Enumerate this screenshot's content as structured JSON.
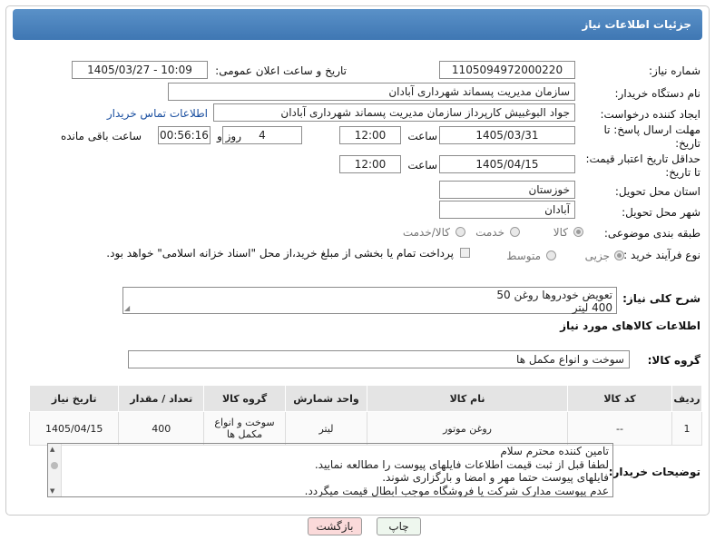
{
  "header": {
    "title": "جزئیات اطلاعات نیاز"
  },
  "form": {
    "need_number_label": "شماره نیاز:",
    "need_number": "1105094972000220",
    "announce_label": "تاریخ و ساعت اعلان عمومی:",
    "announce_value": "1405/03/27 - 10:09",
    "buyer_org_label": "نام دستگاه خریدار:",
    "buyer_org": "سازمان مدیریت پسماند شهرداری آبادان",
    "creator_label": "ایجاد کننده درخواست:",
    "creator": "جواد البوغبیش کارپرداز سازمان مدیریت پسماند شهرداری آبادان",
    "contact_link": "اطلاعات تماس خریدار",
    "reply_deadline_label_1": "مهلت ارسال پاسخ: تا",
    "reply_deadline_label_2": "تاریخ:",
    "reply_date": "1405/03/31",
    "time_label": "ساعت",
    "reply_time": "12:00",
    "days_value": "4",
    "days_label": "روز و",
    "remaining_time": "00:56:16",
    "remaining_label": "ساعت باقی مانده",
    "price_deadline_label_1": "حداقل تاریخ اعتبار قیمت:",
    "price_deadline_label_2": "تا تاریخ:",
    "price_date": "1405/04/15",
    "price_time": "12:00",
    "province_label": "استان محل تحویل:",
    "province": "خوزستان",
    "city_label": "شهر محل تحویل:",
    "city": "آبادان",
    "category_label": "طبقه بندی موضوعی:",
    "category_options": [
      "کالا",
      "خدمت",
      "کالا/خدمت"
    ],
    "process_label": "نوع فرآیند خرید :",
    "process_options": [
      "جزیی",
      "متوسط"
    ],
    "payment_note": "پرداخت تمام یا بخشی از مبلغ خرید،از محل \"اسناد خزانه اسلامی\" خواهد بود."
  },
  "description": {
    "label": "شرح کلی نیاز:",
    "line1": "تعویض خودروها روغن 50",
    "line2": "400 لیتر"
  },
  "goods_info_title": "اطلاعات کالاهای مورد نیاز",
  "goods_group": {
    "label": "گروه کالا:",
    "value": "سوخت و انواع مکمل ها"
  },
  "table": {
    "headers": [
      "ردیف",
      "کد کالا",
      "نام کالا",
      "واحد شمارش",
      "گروه کالا",
      "تعداد / مقدار",
      "تاریخ نیاز"
    ],
    "rows": [
      {
        "row": "1",
        "code": "--",
        "name": "روغن موتور",
        "unit": "لیتر",
        "group_line1": "سوخت و انواع",
        "group_line2": "مکمل ها",
        "qty": "400",
        "date": "1405/04/15"
      }
    ]
  },
  "buyer_notes": {
    "label": "توضیحات خریدار:",
    "lines": [
      "تامین کننده محترم سلام",
      "لطفا قبل از ثبت قیمت اطلاعات فایلهای پیوست را مطالعه نمایید.",
      "فایلهای پیوست حتما مهر و امضا و بارگزاری شوند.",
      "عدم پیوست مدارک شرکت یا فروشگاه موجب ابطال قیمت میگردد."
    ]
  },
  "buttons": {
    "print": "چاپ",
    "back": "بازگشت"
  },
  "colors": {
    "header": "#4a83bf",
    "back_button": "#fbdada",
    "print_button": "#eef7ee",
    "link": "#1a4fa0"
  }
}
